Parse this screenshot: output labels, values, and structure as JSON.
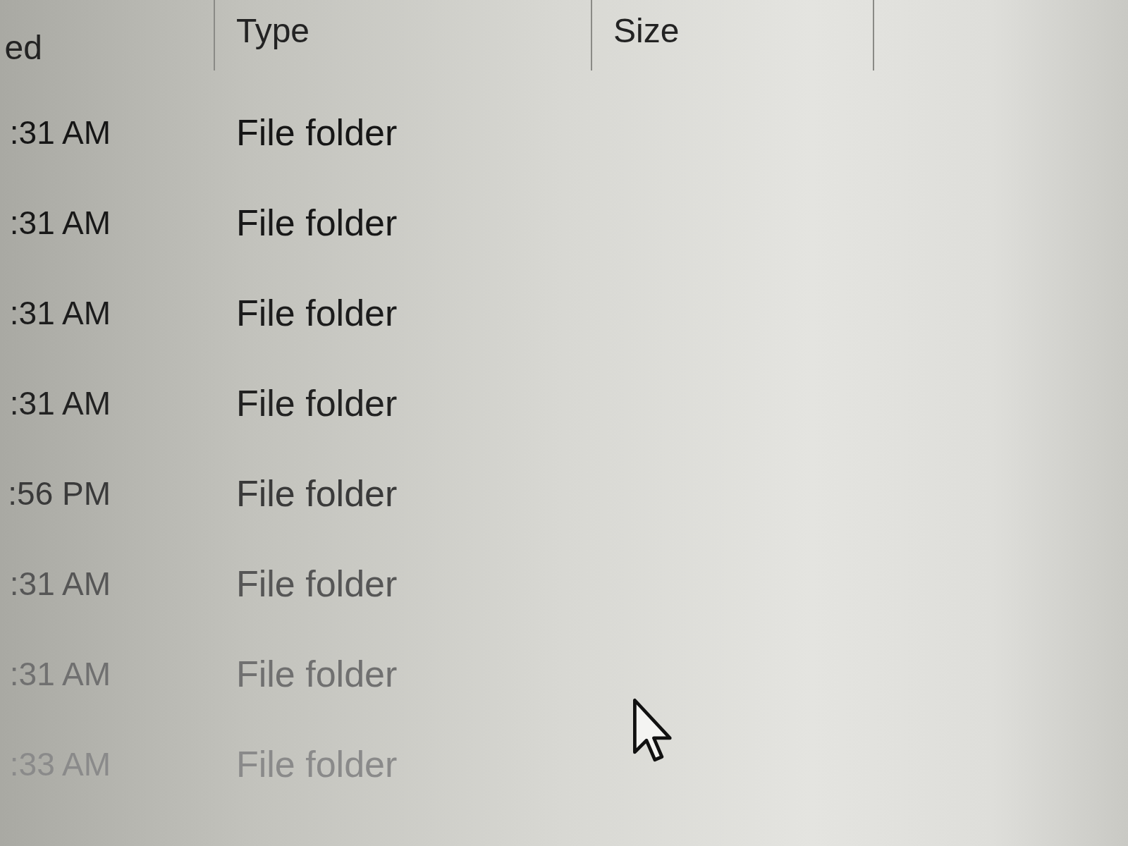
{
  "columns": [
    {
      "label": "ed"
    },
    {
      "label": "Type"
    },
    {
      "label": "Size"
    }
  ],
  "rows": [
    {
      "column_1": ":31 AM",
      "type": "File folder"
    },
    {
      "column_1": ":31 AM",
      "type": "File folder"
    },
    {
      "column_1": ":31 AM",
      "type": "File folder"
    },
    {
      "column_1": ":31 AM",
      "type": "File folder"
    },
    {
      "column_1": ":56 PM",
      "type": "File folder"
    },
    {
      "column_1": ":31 AM",
      "type": "File folder"
    },
    {
      "column_1": ":31 AM",
      "type": "File folder"
    },
    {
      "column_1": ":33 AM",
      "type": "File folder"
    }
  ]
}
